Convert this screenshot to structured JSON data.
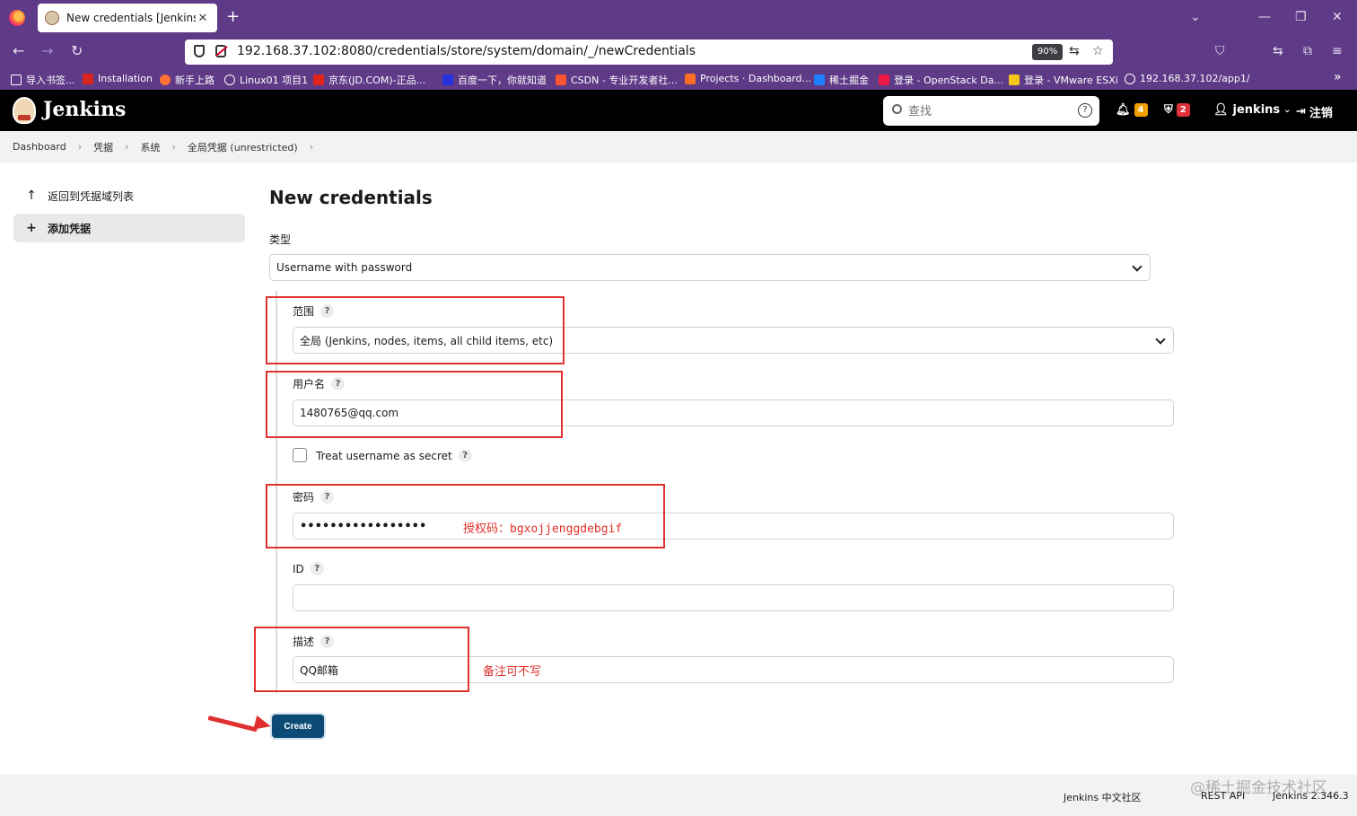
{
  "browser": {
    "tab_title": "New credentials [Jenkins]",
    "new_tab": "+",
    "url": "192.168.37.102:8080/credentials/store/system/domain/_/newCredentials",
    "zoom": "90%",
    "bookmarks": [
      {
        "label": "导入书签...",
        "color": "#ffffff"
      },
      {
        "label": "Installation",
        "color": "#d9251d"
      },
      {
        "label": "新手上路",
        "color": "#ff7139"
      },
      {
        "label": "Linux01 项目1",
        "color": "#ffffff"
      },
      {
        "label": "京东(JD.COM)-正品...",
        "color": "#e1251b"
      },
      {
        "label": "百度一下，你就知道",
        "color": "#2932e1"
      },
      {
        "label": "CSDN - 专业开发者社...",
        "color": "#fc5531"
      },
      {
        "label": "Projects · Dashboard...",
        "color": "#fc6d26"
      },
      {
        "label": "稀土掘金",
        "color": "#1e80ff"
      },
      {
        "label": "登录 - OpenStack Da...",
        "color": "#ed1944"
      },
      {
        "label": "登录 - VMware ESXi",
        "color": "#f5c518"
      },
      {
        "label": "192.168.37.102/app1/",
        "color": "#ffffff"
      }
    ]
  },
  "header": {
    "brand": "Jenkins",
    "search_placeholder": "查找",
    "notifications_count": "4",
    "notifications_color": "#f0a000",
    "security_count": "2",
    "security_color": "#e0303a",
    "user": "jenkins",
    "logout": "注销"
  },
  "breadcrumb": [
    "Dashboard",
    "凭据",
    "系统",
    "全局凭据 (unrestricted)"
  ],
  "sidebar": {
    "items": [
      {
        "icon": "arrow-up-icon",
        "label": "返回到凭据域列表"
      },
      {
        "icon": "plus-icon",
        "label": "添加凭据"
      }
    ]
  },
  "form": {
    "title": "New credentials",
    "kind_label": "类型",
    "kind_value": "Username with password",
    "scope_label": "范围",
    "scope_value": "全局 (Jenkins, nodes, items, all child items, etc)",
    "username_label": "用户名",
    "username_value": "1480765@qq.com",
    "secret_checkbox_label": "Treat username as secret",
    "password_label": "密码",
    "password_value": "•••••••••••••••••",
    "id_label": "ID",
    "id_value": "",
    "description_label": "描述",
    "description_value": "QQ邮箱",
    "help": "?",
    "create_button": "Create"
  },
  "annotations": {
    "password_note": "授权码：bgxojjenggdebgif",
    "description_note": "备注可不写",
    "color": "#e03030"
  },
  "footer": {
    "community": "Jenkins 中文社区",
    "rest_api": "REST API",
    "version": "Jenkins 2.346.3",
    "watermark": "@稀土掘金技术社区"
  }
}
